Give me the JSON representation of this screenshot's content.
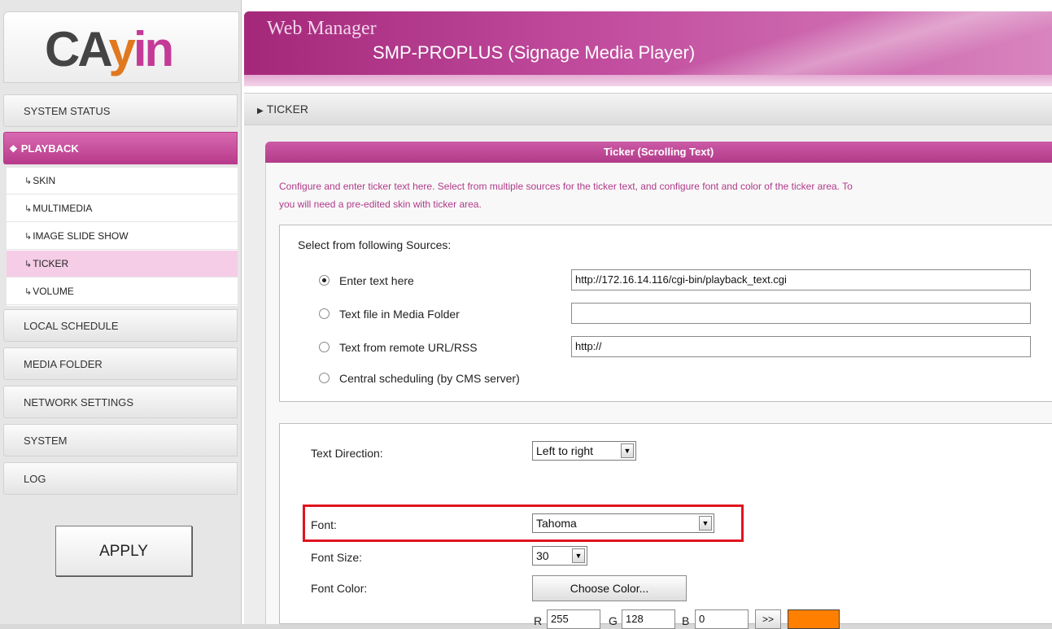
{
  "logo": {
    "text_a": "CA",
    "text_y": "y",
    "text_in": "in"
  },
  "header": {
    "title": "Web Manager",
    "subtitle": "SMP-PROPLUS (Signage Media Player)"
  },
  "breadcrumb": {
    "label": "TICKER"
  },
  "nav": {
    "system_status": "SYSTEM STATUS",
    "playback": "PLAYBACK",
    "submenu": [
      "SKIN",
      "MULTIMEDIA",
      "IMAGE SLIDE SHOW",
      "TICKER",
      "VOLUME"
    ],
    "submenu_active": "TICKER",
    "local_schedule": "LOCAL SCHEDULE",
    "media_folder": "MEDIA FOLDER",
    "network_settings": "NETWORK SETTINGS",
    "system": "SYSTEM",
    "log": "LOG",
    "apply": "APPLY"
  },
  "panel": {
    "title": "Ticker (Scrolling Text)",
    "desc_line1": "Configure and enter ticker text here. Select from multiple sources for the ticker text, and configure font and color of the ticker area. To",
    "desc_line2": "you will need a pre-edited skin with ticker area."
  },
  "sources": {
    "heading": "Select from following Sources:",
    "options": [
      {
        "label": "Enter text here",
        "value": "http://172.16.14.116/cgi-bin/playback_text.cgi",
        "checked": true
      },
      {
        "label": "Text file in Media Folder",
        "value": "",
        "checked": false
      },
      {
        "label": "Text from remote URL/RSS",
        "value": "http://",
        "checked": false
      },
      {
        "label": "Central scheduling (by CMS server)",
        "value": null,
        "checked": false
      }
    ]
  },
  "settings": {
    "direction_label": "Text Direction:",
    "direction_value": "Left to right",
    "font_label": "Font:",
    "font_value": "Tahoma",
    "size_label": "Font Size:",
    "size_value": "30",
    "color_label": "Font Color:",
    "choose_color": "Choose Color...",
    "r_label": "R",
    "r_value": "255",
    "g_label": "G",
    "g_value": "128",
    "b_label": "B",
    "b_value": "0",
    "apply_rgb": ">>",
    "swatch_color": "#ff8000"
  },
  "colors": {
    "brand": "#b83a8b",
    "highlight": "#e0141e"
  }
}
